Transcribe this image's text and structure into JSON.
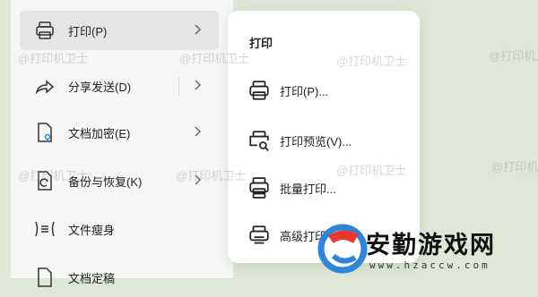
{
  "left_menu": {
    "items": [
      {
        "label": "打印(P)",
        "icon": "printer-icon"
      },
      {
        "label": "分享发送(D)",
        "icon": "share-icon"
      },
      {
        "label": "文档加密(E)",
        "icon": "document-lock-icon"
      },
      {
        "label": "备份与恢复(K)",
        "icon": "backup-icon"
      },
      {
        "label": "文件瘦身",
        "icon": "compress-icon"
      },
      {
        "label": "文档定稿",
        "icon": "document-icon"
      }
    ]
  },
  "submenu": {
    "title": "打印",
    "items": [
      {
        "label": "打印(P)...",
        "icon": "printer-icon"
      },
      {
        "label": "打印预览(V)...",
        "icon": "print-preview-icon"
      },
      {
        "label": "批量打印...",
        "icon": "batch-print-icon"
      },
      {
        "label": "高级打印",
        "icon": "advanced-print-icon"
      }
    ]
  },
  "watermark": {
    "text": "@打印机卫士"
  },
  "logo": {
    "name": "安勤游戏网",
    "url": "www.hzaccw.com"
  },
  "colors": {
    "background": "#dfe8d6",
    "menu": "#f6f6f5",
    "active": "#e5e5e4",
    "logo_blue": "#2f86d8",
    "logo_red": "#e83a2c"
  }
}
